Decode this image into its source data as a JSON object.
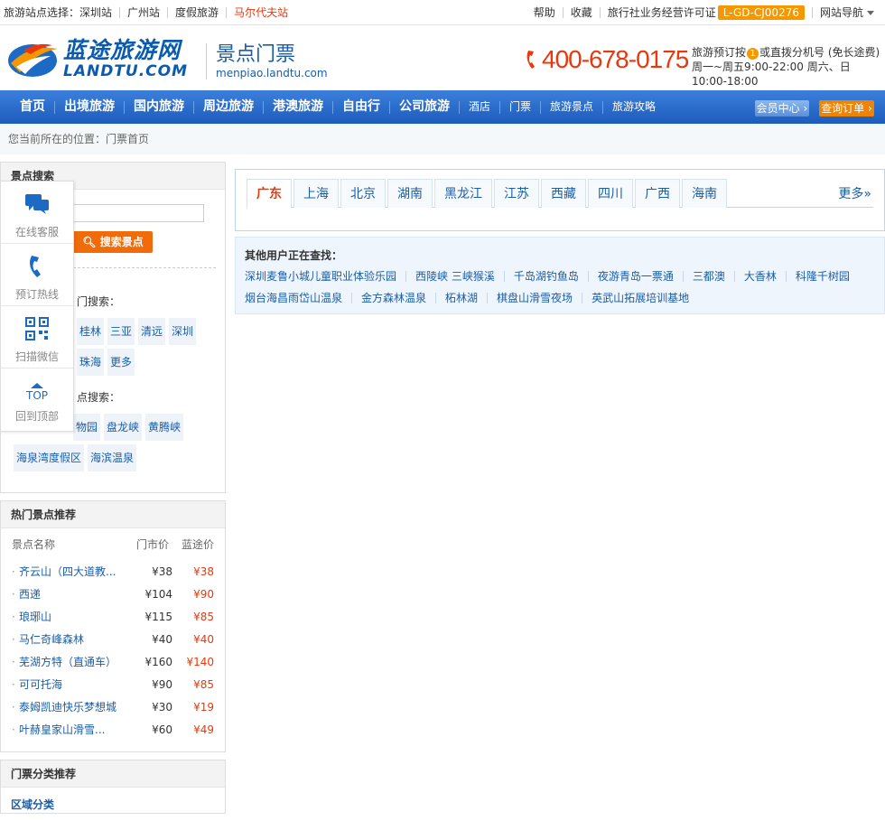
{
  "topbar": {
    "station_label": "旅游站点选择：",
    "stations": [
      "深圳站",
      "广州站",
      "度假旅游",
      "马尔代夫站"
    ],
    "help": "帮助",
    "fav": "收藏",
    "license_label": "旅行社业务经营许可证",
    "license_code": "L-GD-CJ00276",
    "site_nav": "网站导航"
  },
  "header": {
    "logo_cn": "蓝途旅游网",
    "logo_en": "LANDTU.COM",
    "site_title": "景点门票",
    "site_domain": "menpiao.landtu.com",
    "hotline": "400-678-0175",
    "hot_info_line1_a": "旅游预订按",
    "hot_info_key": "1",
    "hot_info_line1_b": "或直拨分机号 (免长途费)",
    "hot_info_line2": "周一~周五9:00-22:00 周六、日10:00-18:00"
  },
  "nav": {
    "items": [
      "首页",
      "出境旅游",
      "国内旅游",
      "周边旅游",
      "港澳旅游",
      "自由行",
      "公司旅游"
    ],
    "small_items": [
      "酒店",
      "门票",
      "旅游景点",
      "旅游攻略"
    ],
    "member": "会员中心",
    "order": "查询订单"
  },
  "breadcrumb": {
    "label": "您当前所在的位置：",
    "current": "门票首页"
  },
  "search": {
    "title": "景点搜索",
    "button": "搜索景点",
    "label1": "门搜索：",
    "tags1_row1": [
      "桂林",
      "三亚",
      "清远",
      "深圳"
    ],
    "tags1_row2": [
      "珠海",
      "更多"
    ],
    "label2": "点搜索：",
    "tags2_row1": [
      "物园",
      "盘龙峡",
      "黄腾峡"
    ],
    "tags2_row2": [
      "海泉湾度假区",
      "海滨温泉"
    ]
  },
  "float": {
    "items": [
      "在线客服",
      "预订热线",
      "扫描微信",
      "回到顶部"
    ],
    "top_text": "TOP"
  },
  "hot": {
    "title": "热门景点推荐",
    "col_name": "景点名称",
    "col_market": "门市价",
    "col_price": "蓝途价",
    "rows": [
      {
        "name": "齐云山（四大道教...",
        "market": "¥38",
        "price": "¥38"
      },
      {
        "name": "西递",
        "market": "¥104",
        "price": "¥90"
      },
      {
        "name": "琅琊山",
        "market": "¥115",
        "price": "¥85"
      },
      {
        "name": "马仁奇峰森林",
        "market": "¥40",
        "price": "¥40"
      },
      {
        "name": "芜湖方特（直通车）",
        "market": "¥160",
        "price": "¥140"
      },
      {
        "name": "可可托海",
        "market": "¥90",
        "price": "¥85"
      },
      {
        "name": "泰姆凯迪快乐梦想城",
        "market": "¥30",
        "price": "¥19"
      },
      {
        "name": "叶赫皇家山滑雪...",
        "market": "¥60",
        "price": "¥49"
      }
    ]
  },
  "category": {
    "title": "门票分类推荐",
    "sub": "区域分类"
  },
  "tabs": {
    "items": [
      "广东",
      "上海",
      "北京",
      "湖南",
      "黑龙江",
      "江苏",
      "西藏",
      "四川",
      "广西",
      "海南"
    ],
    "more": "更多»"
  },
  "others": {
    "title": "其他用户正在查找：",
    "row1": [
      "深圳麦鲁小城儿童职业体验乐园",
      "西陵峡 三峡猴溪",
      "千岛湖钓鱼岛",
      "夜游青岛一票通",
      "三都澳",
      "大香林",
      "科隆千树园"
    ],
    "row2": [
      "烟台海昌雨岱山温泉",
      "金方森林温泉",
      "柘林湖",
      "棋盘山滑雪夜场",
      "英武山拓展培训基地"
    ]
  },
  "colors": {
    "brand_blue": "#1d5cbd",
    "accent_orange": "#f06b0a",
    "price_red": "#e8380d"
  }
}
